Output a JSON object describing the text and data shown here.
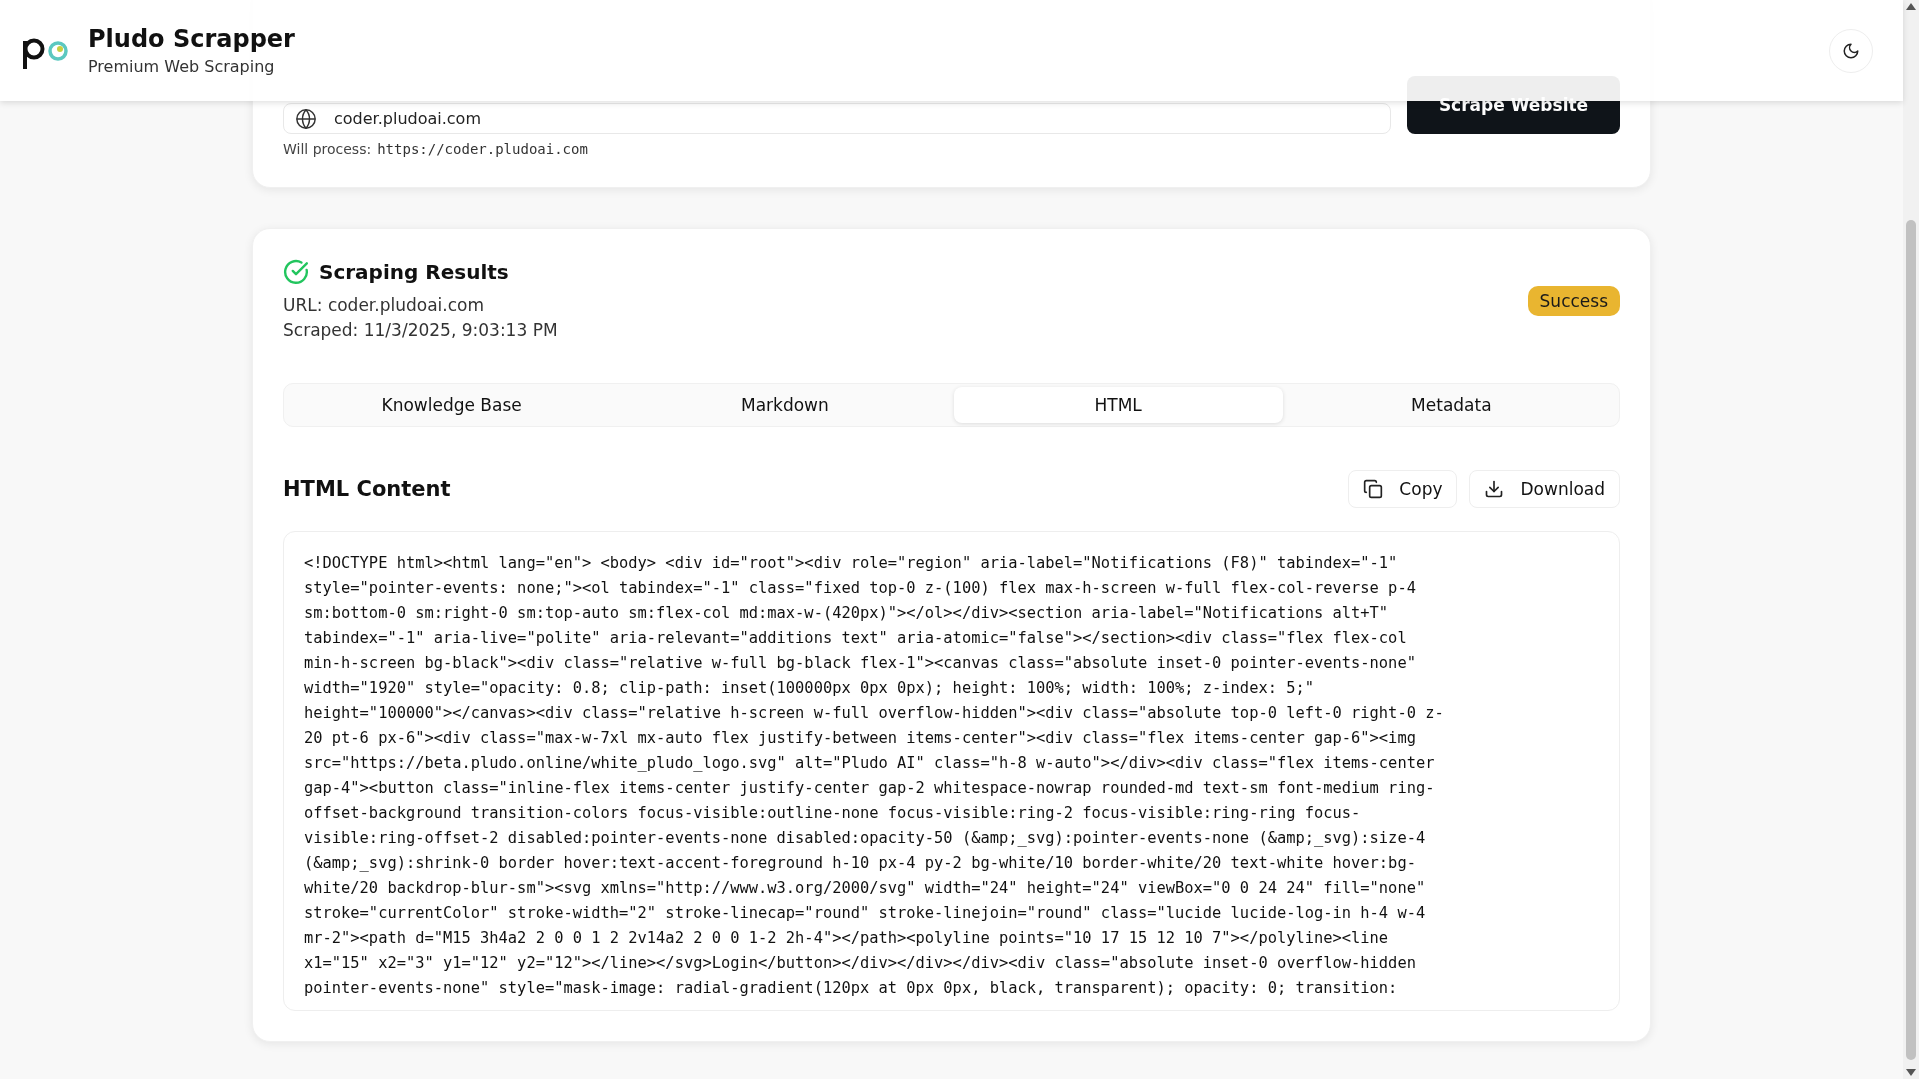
{
  "header": {
    "title": "Pludo Scrapper",
    "subtitle": "Premium Web Scraping"
  },
  "scrape_form": {
    "url_field": {
      "value": "coder.pludoai.com"
    },
    "submit_button": "Scrape Website",
    "process_label": "Will process:",
    "process_url": "https://coder.pludoai.com"
  },
  "results": {
    "title": "Scraping Results",
    "url_label": "URL:",
    "url": "coder.pludoai.com",
    "scraped_label": "Scraped:",
    "scraped": "11/3/2025, 9:03:13 PM",
    "status": "Success",
    "tabs": [
      {
        "label": "Knowledge Base",
        "selected": false
      },
      {
        "label": "Markdown",
        "selected": false
      },
      {
        "label": "HTML",
        "selected": true
      },
      {
        "label": "Metadata",
        "selected": false
      }
    ],
    "content_title": "HTML Content",
    "actions": [
      {
        "kind": "copy",
        "label": "Copy"
      },
      {
        "kind": "download",
        "label": "Download"
      }
    ],
    "code_lines": [
      "<!DOCTYPE html><html lang=\"en\"> <body> <div id=\"root\"><div role=\"region\" aria-label=\"Notifications (F8)\" tabindex=\"-1\"",
      "style=\"pointer-events: none;\"><ol tabindex=\"-1\" class=\"fixed top-0 z-(100) flex max-h-screen w-full flex-col-reverse p-4",
      "sm:bottom-0 sm:right-0 sm:top-auto sm:flex-col md:max-w-(420px)\"></ol></div><section aria-label=\"Notifications alt+T\"",
      "tabindex=\"-1\" aria-live=\"polite\" aria-relevant=\"additions text\" aria-atomic=\"false\"></section><div class=\"flex flex-col",
      "min-h-screen bg-black\"><div class=\"relative w-full bg-black flex-1\"><canvas class=\"absolute inset-0 pointer-events-none\"",
      "width=\"1920\" style=\"opacity: 0.8; clip-path: inset(100000px 0px 0px); height: 100%; width: 100%; z-index: 5;\"",
      "height=\"100000\"></canvas><div class=\"relative h-screen w-full overflow-hidden\"><div class=\"absolute top-0 left-0 right-0 z-",
      "20 pt-6 px-6\"><div class=\"max-w-7xl mx-auto flex justify-between items-center\"><div class=\"flex items-center gap-6\"><img",
      "src=\"https://beta.pludo.online/white_pludo_logo.svg\" alt=\"Pludo AI\" class=\"h-8 w-auto\"></div><div class=\"flex items-center",
      "gap-4\"><button class=\"inline-flex items-center justify-center gap-2 whitespace-nowrap rounded-md text-sm font-medium ring-",
      "offset-background transition-colors focus-visible:outline-none focus-visible:ring-2 focus-visible:ring-ring focus-",
      "visible:ring-offset-2 disabled:pointer-events-none disabled:opacity-50 (&amp;_svg):pointer-events-none (&amp;_svg):size-4",
      "(&amp;_svg):shrink-0 border hover:text-accent-foreground h-10 px-4 py-2 bg-white/10 border-white/20 text-white hover:bg-",
      "white/20 backdrop-blur-sm\"><svg xmlns=\"http://www.w3.org/2000/svg\" width=\"24\" height=\"24\" viewBox=\"0 0 24 24\" fill=\"none\"",
      "stroke=\"currentColor\" stroke-width=\"2\" stroke-linecap=\"round\" stroke-linejoin=\"round\" class=\"lucide lucide-log-in h-4 w-4",
      "mr-2\"><path d=\"M15 3h4a2 2 0 0 1 2 2v14a2 2 0 0 1-2 2h-4\"></path><polyline points=\"10 17 15 12 10 7\"></polyline><line",
      "x1=\"15\" x2=\"3\" y1=\"12\" y2=\"12\"></line></svg>Login</button></div></div></div><div class=\"absolute inset-0 overflow-hidden",
      "pointer-events-none\" style=\"mask-image: radial-gradient(120px at 0px 0px, black, transparent); opacity: 0; transition:"
    ]
  }
}
